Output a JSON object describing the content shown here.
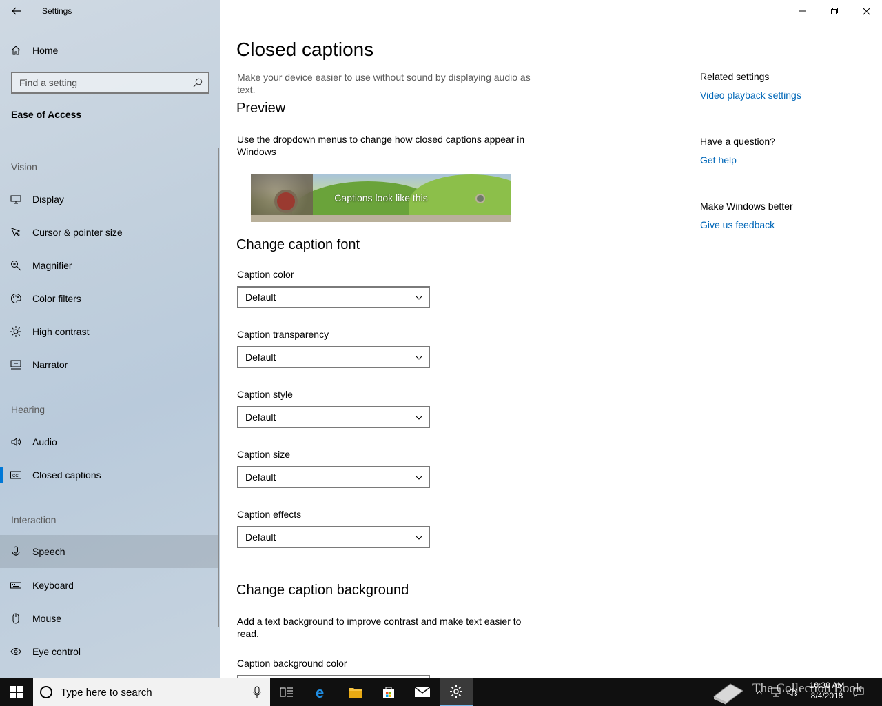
{
  "window": {
    "app_title": "Settings",
    "controls": {
      "minimize": "—",
      "maximize": "☐",
      "close": "✕"
    }
  },
  "sidebar": {
    "home_label": "Home",
    "search_placeholder": "Find a setting",
    "section_title": "Ease of Access",
    "groups": {
      "vision": "Vision",
      "hearing": "Hearing",
      "interaction": "Interaction"
    },
    "items": [
      {
        "label": "Display",
        "icon": "monitor-icon"
      },
      {
        "label": "Cursor & pointer size",
        "icon": "cursor-icon"
      },
      {
        "label": "Magnifier",
        "icon": "magnifier-icon"
      },
      {
        "label": "Color filters",
        "icon": "palette-icon"
      },
      {
        "label": "High contrast",
        "icon": "sun-icon"
      },
      {
        "label": "Narrator",
        "icon": "narrator-icon"
      },
      {
        "label": "Audio",
        "icon": "speaker-icon"
      },
      {
        "label": "Closed captions",
        "icon": "cc-icon",
        "selected": true
      },
      {
        "label": "Speech",
        "icon": "microphone-icon",
        "hovered": true
      },
      {
        "label": "Keyboard",
        "icon": "keyboard-icon"
      },
      {
        "label": "Mouse",
        "icon": "mouse-icon"
      },
      {
        "label": "Eye control",
        "icon": "eye-icon"
      }
    ]
  },
  "main": {
    "title": "Closed captions",
    "description": "Make your device easier to use without sound by displaying audio as text.",
    "preview_heading": "Preview",
    "preview_description": "Use the dropdown menus to change how closed captions appear in Windows",
    "preview_caption": "Captions look like this",
    "font_heading": "Change caption font",
    "font_fields": [
      {
        "label": "Caption color",
        "value": "Default"
      },
      {
        "label": "Caption transparency",
        "value": "Default"
      },
      {
        "label": "Caption style",
        "value": "Default"
      },
      {
        "label": "Caption size",
        "value": "Default"
      },
      {
        "label": "Caption effects",
        "value": "Default"
      }
    ],
    "background_heading": "Change caption background",
    "background_description": "Add a text background to improve contrast and make text easier to read.",
    "background_color_label": "Caption background color"
  },
  "related": {
    "related_title": "Related settings",
    "related_link": "Video playback settings",
    "question_title": "Have a question?",
    "question_link": "Get help",
    "better_title": "Make Windows better",
    "better_link": "Give us feedback"
  },
  "taskbar": {
    "search_placeholder": "Type here to search",
    "time": "10:38 AM",
    "date": "8/4/2018",
    "watermark": "The Collection Book",
    "accent_color": "#0078d7"
  }
}
